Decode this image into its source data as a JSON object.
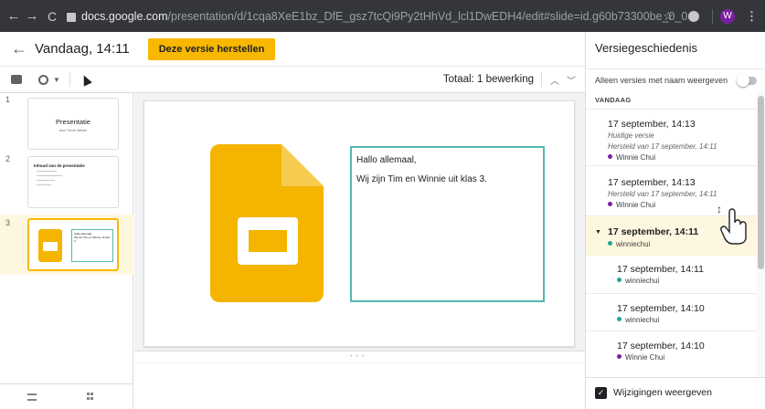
{
  "browser": {
    "url_host": "docs.google.com",
    "url_path": "/presentation/d/1cqa8XeE1bz_DfE_gsz7tcQi9Py2tHhVd_lcl1DwEDH4/edit#slide=id.g60b73300be_0_0",
    "profile_initial": "W",
    "icons": [
      "back-arrow-icon",
      "forward-arrow-icon",
      "reload-icon",
      "lock-icon",
      "star-icon",
      "extension-icon",
      "more-icon"
    ]
  },
  "topbar": {
    "title": "Vandaag, 14:11",
    "restore_label": "Deze versie herstellen"
  },
  "toolbar": {
    "total_label": "Totaal: 1 bewerking"
  },
  "filmstrip": {
    "slides": [
      {
        "number": "1",
        "title": "Presentatie",
        "subtitle": "door Tim en Winnie"
      },
      {
        "number": "2",
        "title": "Inhoud van de presentatie"
      },
      {
        "number": "3",
        "text_line1": "Hallo allemaal,",
        "text_line2": "Wij zijn Tim en Winnie uit klas 3."
      }
    ]
  },
  "slide": {
    "line1": "Hallo allemaal,",
    "line2": "Wij zijn Tim en Winnie uit klas 3."
  },
  "panel": {
    "title": "Versiegeschiedenis",
    "named_only_label": "Alleen versies met naam weergeven",
    "named_only_enabled": false,
    "section_label": "VANDAAG",
    "versions": [
      {
        "time": "17 september, 14:13",
        "sub1": "Huidige versie",
        "sub2": "Hersteld van 17 september, 14:11",
        "user": "Winnie Chui",
        "user_color": "#7b1fa2"
      },
      {
        "time": "17 september, 14:13",
        "sub1": "Hersteld van 17 september, 14:11",
        "user": "Winnie Chui",
        "user_color": "#7b1fa2"
      },
      {
        "time": "17 september, 14:11",
        "user": "winniechui",
        "user_color": "#26a69a",
        "selected": true,
        "expanded": true
      },
      {
        "time": "17 september, 14:11",
        "user": "winniechui",
        "user_color": "#26a69a"
      },
      {
        "time": "17 september, 14:10",
        "user": "winniechui",
        "user_color": "#26a69a"
      },
      {
        "time": "17 september, 14:10",
        "user": "Winnie Chui",
        "user_color": "#7b1fa2"
      }
    ],
    "show_changes_label": "Wijzigingen weergeven",
    "show_changes_checked": true
  },
  "colors": {
    "accent_yellow": "#f9b800",
    "selection_bg": "#fef7e0",
    "textbox_border": "#54b8b0",
    "chrome_bg": "#35363a"
  }
}
